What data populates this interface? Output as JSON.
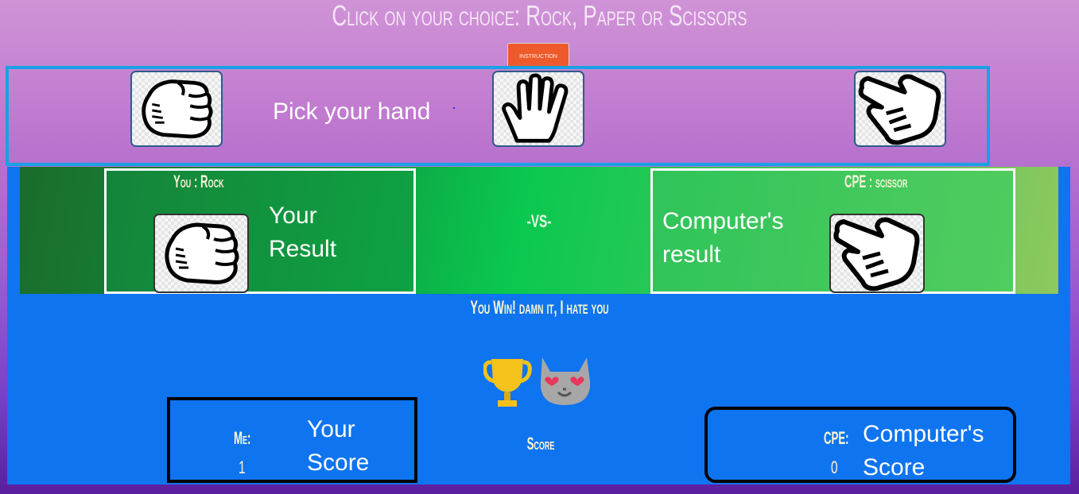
{
  "header": {
    "title": "Click on your choice: Rock, Paper or Scissors",
    "instruction_button": "instruction"
  },
  "picker": {
    "label": "Pick your hand",
    "choices": [
      {
        "name": "Rock",
        "icon": "fist-icon"
      },
      {
        "name": "Paper",
        "icon": "open-hand-icon"
      },
      {
        "name": "Scissors",
        "icon": "scissors-hand-icon"
      }
    ]
  },
  "arena": {
    "you_heading": "You : Rock",
    "you_label_line1": "Your",
    "you_label_line2": "Result",
    "vs": "-VS-",
    "cpe_heading": "CPE : scissor",
    "cpe_label_line1": "Computer's",
    "cpe_label_line2": "result",
    "message": "You Win! damn it, I hate you",
    "emojis": [
      "trophy-icon",
      "heart-eyes-cat-icon"
    ]
  },
  "score": {
    "caption": "Score",
    "me_key": "Me:",
    "me_value": "1",
    "me_label_line1": "Your",
    "me_label_line2": "Score",
    "cpe_key": "CPE:",
    "cpe_value": "0",
    "cpe_label_line1": "Computer's",
    "cpe_label_line2": "Score"
  },
  "colors": {
    "pick_frame": "#1aa0e6",
    "arena_background": "#0f74ef",
    "instruction_button": "#ee5a2b",
    "text_light": "#fff7cf"
  }
}
